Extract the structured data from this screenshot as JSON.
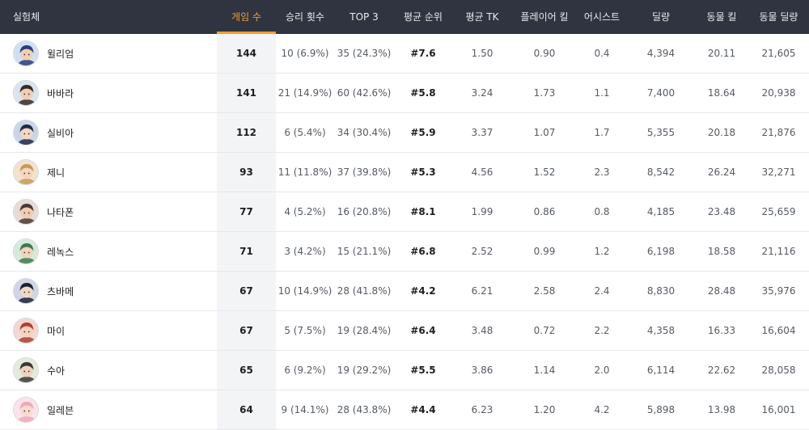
{
  "headers": {
    "name": "실험체",
    "games": "게임 수",
    "wins": "승리 횟수",
    "top3": "TOP 3",
    "avg_rank": "평균 순위",
    "avg_tk": "평균 TK",
    "player_kills": "플레이어 킬",
    "assists": "어시스트",
    "damage": "딜량",
    "animal_kills": "동물 킬",
    "animal_damage": "동물 딜량"
  },
  "sorted_column": "games",
  "colors": {
    "header_bg": "#2f3440",
    "accent": "#f0a030",
    "sorted_bg": "#f3f4f6"
  },
  "rows": [
    {
      "name": "윌리엄",
      "avatar": "william-avatar",
      "games": "144",
      "wins": "10 (6.9%)",
      "top3": "35 (24.3%)",
      "avg_rank": "#7.6",
      "avg_tk": "1.50",
      "player_kills": "0.90",
      "assists": "0.4",
      "damage": "4,394",
      "animal_kills": "20.11",
      "animal_damage": "21,605",
      "hair": "#2b3d73",
      "skin": "#f2cfb4",
      "bg": "#cfe0f5"
    },
    {
      "name": "바바라",
      "avatar": "barbara-avatar",
      "games": "141",
      "wins": "21 (14.9%)",
      "top3": "60 (42.6%)",
      "avg_rank": "#5.8",
      "avg_tk": "3.24",
      "player_kills": "1.73",
      "assists": "1.1",
      "damage": "7,400",
      "animal_kills": "18.64",
      "animal_damage": "20,938",
      "hair": "#3a2a24",
      "skin": "#f1cdb3",
      "bg": "#d8e4f2"
    },
    {
      "name": "실비아",
      "avatar": "silvia-avatar",
      "games": "112",
      "wins": "6 (5.4%)",
      "top3": "34 (30.4%)",
      "avg_rank": "#5.9",
      "avg_tk": "3.37",
      "player_kills": "1.07",
      "assists": "1.7",
      "damage": "5,355",
      "animal_kills": "20.18",
      "animal_damage": "21,876",
      "hair": "#1f2a44",
      "skin": "#f3d6c3",
      "bg": "#c9d6ea"
    },
    {
      "name": "제니",
      "avatar": "jenny-avatar",
      "games": "93",
      "wins": "11 (11.8%)",
      "top3": "37 (39.8%)",
      "avg_rank": "#5.3",
      "avg_tk": "4.56",
      "player_kills": "1.52",
      "assists": "2.3",
      "damage": "8,542",
      "animal_kills": "26.24",
      "animal_damage": "32,271",
      "hair": "#c99a55",
      "skin": "#f4d5bd",
      "bg": "#f2e3cf"
    },
    {
      "name": "나타폰",
      "avatar": "nathapon-avatar",
      "games": "77",
      "wins": "4 (5.2%)",
      "top3": "16 (20.8%)",
      "avg_rank": "#8.1",
      "avg_tk": "1.99",
      "player_kills": "0.86",
      "assists": "0.8",
      "damage": "4,185",
      "animal_kills": "23.48",
      "animal_damage": "25,659",
      "hair": "#4a3a33",
      "skin": "#f0cdb1",
      "bg": "#e6dcd5"
    },
    {
      "name": "레녹스",
      "avatar": "lenox-avatar",
      "games": "71",
      "wins": "3 (4.2%)",
      "top3": "15 (21.1%)",
      "avg_rank": "#6.8",
      "avg_tk": "2.52",
      "player_kills": "0.99",
      "assists": "1.2",
      "damage": "6,198",
      "animal_kills": "18.58",
      "animal_damage": "21,116",
      "hair": "#3f7a4c",
      "skin": "#f2d3bc",
      "bg": "#d7ead9"
    },
    {
      "name": "츠바메",
      "avatar": "tsubame-avatar",
      "games": "67",
      "wins": "10 (14.9%)",
      "top3": "28 (41.8%)",
      "avg_rank": "#4.2",
      "avg_tk": "6.21",
      "player_kills": "2.58",
      "assists": "2.4",
      "damage": "8,830",
      "animal_kills": "28.48",
      "animal_damage": "35,976",
      "hair": "#1c2233",
      "skin": "#f3d7c5",
      "bg": "#cfd5e6"
    },
    {
      "name": "마이",
      "avatar": "mai-avatar",
      "games": "67",
      "wins": "5 (7.5%)",
      "top3": "19 (28.4%)",
      "avg_rank": "#6.4",
      "avg_tk": "3.48",
      "player_kills": "0.72",
      "assists": "2.2",
      "damage": "4,358",
      "animal_kills": "16.33",
      "animal_damage": "16,604",
      "hair": "#b2402f",
      "skin": "#f4d4be",
      "bg": "#f2d7d2"
    },
    {
      "name": "수아",
      "avatar": "sua-avatar",
      "games": "65",
      "wins": "6 (9.2%)",
      "top3": "19 (29.2%)",
      "avg_rank": "#5.5",
      "avg_tk": "3.86",
      "player_kills": "1.14",
      "assists": "2.0",
      "damage": "6,114",
      "animal_kills": "22.62",
      "animal_damage": "28,058",
      "hair": "#3b3a36",
      "skin": "#f1d2bc",
      "bg": "#e4eadc"
    },
    {
      "name": "일레븐",
      "avatar": "eleven-avatar",
      "games": "64",
      "wins": "9 (14.1%)",
      "top3": "28 (43.8%)",
      "avg_rank": "#4.4",
      "avg_tk": "6.23",
      "player_kills": "1.20",
      "assists": "4.2",
      "damage": "5,898",
      "animal_kills": "13.98",
      "animal_damage": "16,001",
      "hair": "#f0a8b8",
      "skin": "#f6dccd",
      "bg": "#fbe3ea"
    }
  ]
}
